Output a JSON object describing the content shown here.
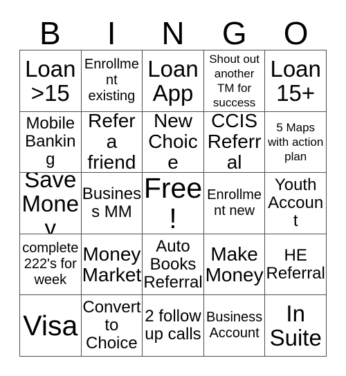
{
  "card": {
    "title": "BINGO",
    "header_letters": [
      "B",
      "I",
      "N",
      "G",
      "O"
    ],
    "colors": {
      "background": "#ffffff",
      "text": "#000000",
      "grid_line": "#4d4d4d"
    },
    "grid": {
      "columns": 5,
      "rows": 5,
      "cells": [
        {
          "text": "Loan >15",
          "size": "xl"
        },
        {
          "text": "Enrollment existing",
          "size": "s"
        },
        {
          "text": "Loan App",
          "size": "xl"
        },
        {
          "text": "Shout out another TM for success",
          "size": "xs"
        },
        {
          "text": "Loan 15+",
          "size": "xl"
        },
        {
          "text": "Mobile Banking",
          "size": "m"
        },
        {
          "text": "Refer a friend",
          "size": "l"
        },
        {
          "text": "New Choice",
          "size": "l"
        },
        {
          "text": "CCIS Referral",
          "size": "l"
        },
        {
          "text": "5 Maps with action plan",
          "size": "xs"
        },
        {
          "text": "Save Money",
          "size": "xl"
        },
        {
          "text": "Business MM",
          "size": "m"
        },
        {
          "text": "Free!",
          "size": "xxl"
        },
        {
          "text": "Enrollment new",
          "size": "s"
        },
        {
          "text": "Youth Account",
          "size": "m"
        },
        {
          "text": "complete 222's for week",
          "size": "s"
        },
        {
          "text": "Money Market",
          "size": "l"
        },
        {
          "text": "Auto Books Referral",
          "size": "m"
        },
        {
          "text": "Make Money",
          "size": "l"
        },
        {
          "text": "HE Referral",
          "size": "m"
        },
        {
          "text": "Visa",
          "size": "xxl"
        },
        {
          "text": "Convert to Choice",
          "size": "m"
        },
        {
          "text": "2 follow up calls",
          "size": "m"
        },
        {
          "text": "Business Account",
          "size": "s"
        },
        {
          "text": "In Suite",
          "size": "xl"
        }
      ]
    }
  }
}
